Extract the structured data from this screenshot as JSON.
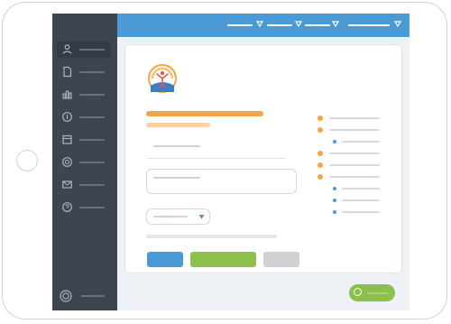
{
  "colors": {
    "topbar": "#4a9ad6",
    "sidebar": "#3e4551",
    "accent_orange": "#f5a34a",
    "accent_orange_light": "#fbd3a2",
    "accent_blue": "#4a9ad6",
    "accent_green": "#8cc04b",
    "neutral_gray": "#cfd1d4"
  },
  "sidebar": {
    "items": [
      {
        "icon": "user-icon"
      },
      {
        "icon": "document-icon"
      },
      {
        "icon": "bar-chart-icon"
      },
      {
        "icon": "info-icon"
      },
      {
        "icon": "calendar-icon"
      },
      {
        "icon": "globe-icon"
      },
      {
        "icon": "mail-icon"
      },
      {
        "icon": "help-icon"
      }
    ],
    "footer_icon": "target-icon"
  },
  "topbar": {
    "menus": [
      {
        "icon": "chevron-down-icon"
      },
      {
        "icon": "chevron-down-icon"
      },
      {
        "icon": "chevron-down-icon"
      },
      {
        "icon": "chevron-down-icon"
      }
    ]
  },
  "card": {
    "logo_icon": "person-sun-logo",
    "select_icon": "chevron-down-icon"
  },
  "toggle": {
    "state": "on"
  }
}
